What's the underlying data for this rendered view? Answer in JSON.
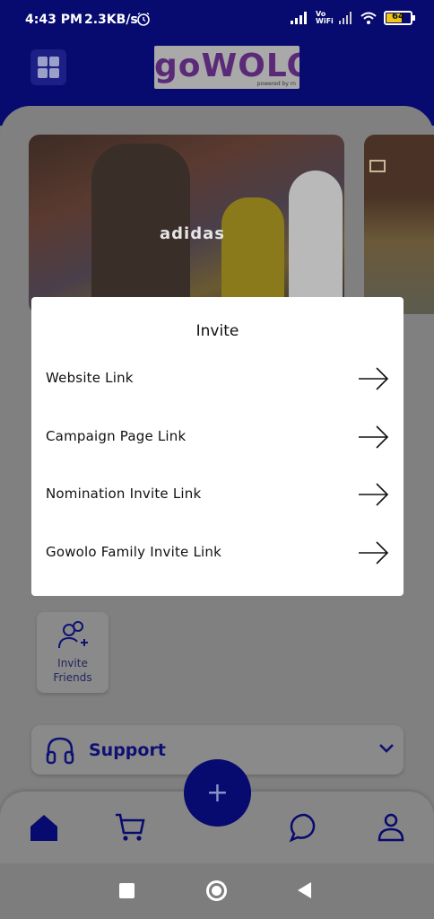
{
  "status_bar": {
    "time": "4:43 PM",
    "speed": "2.3KB/s",
    "network": "Vo WiFi",
    "battery": "64"
  },
  "header": {
    "logo_text": "goWOLO",
    "logo_subtext": "powered by rn"
  },
  "banners": [
    {
      "brand_text": "adidas"
    },
    {
      "brand_text": ""
    }
  ],
  "modal": {
    "title": "Invite",
    "items": [
      {
        "label": "Website Link",
        "icon": "arrow-right-icon"
      },
      {
        "label": "Campaign Page Link",
        "icon": "arrow-right-icon"
      },
      {
        "label": "Nomination Invite Link",
        "icon": "arrow-right-icon"
      },
      {
        "label": "Gowolo Family Invite Link",
        "icon": "arrow-right-icon"
      }
    ]
  },
  "invite_friends": {
    "line1": "Invite",
    "line2": "Friends",
    "icon": "add-user-icon"
  },
  "support": {
    "label": "Support",
    "icon": "headphones-icon"
  },
  "fab": {
    "label": "+"
  },
  "bottom_nav": [
    {
      "name": "home",
      "icon": "home-icon"
    },
    {
      "name": "cart",
      "icon": "cart-icon"
    },
    {
      "name": "chat",
      "icon": "chat-icon"
    },
    {
      "name": "profile",
      "icon": "user-icon"
    }
  ],
  "colors": {
    "brand_navy": "#070a6e",
    "overlay_gray": "#808080",
    "modal_bg": "#ffffff",
    "logo_purple": "#5a2a78"
  }
}
